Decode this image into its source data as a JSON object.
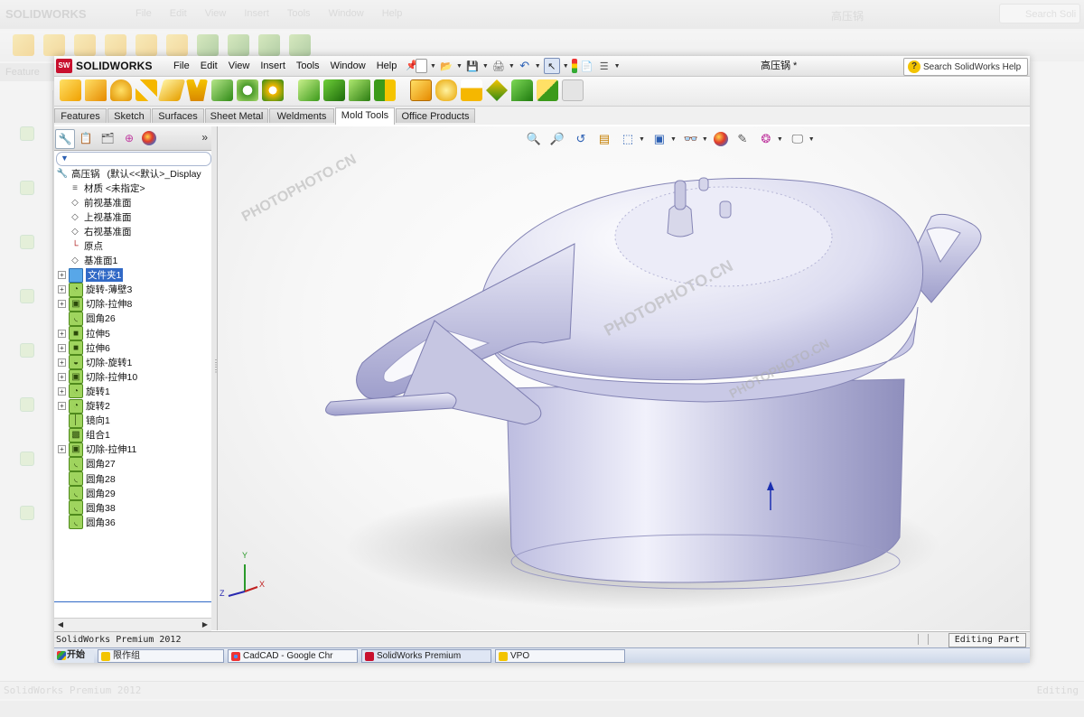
{
  "app": {
    "brand": "SOLIDWORKS",
    "brand_mark": "SW",
    "document_title": "高压锅 *",
    "search_placeholder": "Search SolidWorks Help"
  },
  "menus": [
    "File",
    "Edit",
    "View",
    "Insert",
    "Tools",
    "Window",
    "Help"
  ],
  "command_tabs": [
    {
      "label": "Features",
      "active": false
    },
    {
      "label": "Sketch",
      "active": false
    },
    {
      "label": "Surfaces",
      "active": false
    },
    {
      "label": "Sheet Metal",
      "active": false
    },
    {
      "label": "Weldments",
      "active": false
    },
    {
      "label": "Mold Tools",
      "active": true
    },
    {
      "label": "Office Products",
      "active": false
    }
  ],
  "tree": {
    "root_label": "高压锅",
    "root_config": "(默认<<默认>_Display",
    "items": [
      {
        "label": "材质 <未指定>",
        "icon": "material-icon",
        "expandable": false
      },
      {
        "label": "前视基准面",
        "icon": "plane-icon",
        "expandable": false
      },
      {
        "label": "上视基准面",
        "icon": "plane-icon",
        "expandable": false
      },
      {
        "label": "右视基准面",
        "icon": "plane-icon",
        "expandable": false
      },
      {
        "label": "原点",
        "icon": "origin-icon",
        "expandable": false
      },
      {
        "label": "基准面1",
        "icon": "plane-icon",
        "expandable": false
      },
      {
        "label": "文件夹1",
        "icon": "folder-icon",
        "expandable": true,
        "selected": true
      },
      {
        "label": "旋转-薄壁3",
        "icon": "revolve-icon",
        "expandable": true
      },
      {
        "label": "切除-拉伸8",
        "icon": "cut-extrude-icon",
        "expandable": true
      },
      {
        "label": "圆角26",
        "icon": "fillet-icon",
        "expandable": false
      },
      {
        "label": "拉伸5",
        "icon": "extrude-icon",
        "expandable": true
      },
      {
        "label": "拉伸6",
        "icon": "extrude-icon",
        "expandable": true
      },
      {
        "label": "切除-旋转1",
        "icon": "cut-revolve-icon",
        "expandable": true
      },
      {
        "label": "切除-拉伸10",
        "icon": "cut-extrude-icon",
        "expandable": true
      },
      {
        "label": "旋转1",
        "icon": "revolve-icon",
        "expandable": true
      },
      {
        "label": "旋转2",
        "icon": "revolve-icon",
        "expandable": true
      },
      {
        "label": "镜向1",
        "icon": "mirror-icon",
        "expandable": false
      },
      {
        "label": "组合1",
        "icon": "combine-icon",
        "expandable": false
      },
      {
        "label": "切除-拉伸11",
        "icon": "cut-extrude-icon",
        "expandable": true
      },
      {
        "label": "圆角27",
        "icon": "fillet-icon",
        "expandable": false
      },
      {
        "label": "圆角28",
        "icon": "fillet-icon",
        "expandable": false
      },
      {
        "label": "圆角29",
        "icon": "fillet-icon",
        "expandable": false
      },
      {
        "label": "圆角38",
        "icon": "fillet-icon",
        "expandable": false
      },
      {
        "label": "圆角36",
        "icon": "fillet-icon",
        "expandable": false
      }
    ]
  },
  "viewport": {
    "triad": {
      "x": "X",
      "y": "Y",
      "z": "Z"
    },
    "watermark": "PHOTOPHOTO.CN"
  },
  "status": {
    "left": "SolidWorks Premium 2012",
    "right": "Editing Part"
  },
  "taskbar": [
    "开始",
    "限作组",
    "CadCAD - Google Chr",
    "SolidWorks Premium",
    "VPO"
  ],
  "background": {
    "menus": [
      "File",
      "Edit",
      "View",
      "Insert",
      "Tools",
      "Window",
      "Help"
    ],
    "title": "高压锅",
    "search": "Search Soli",
    "tab": "Feature",
    "status_left": "SolidWorks Premium 2012",
    "status_right": "Editing"
  },
  "colors": {
    "accent": "#c8102e",
    "selection": "#3169c6",
    "feature_icon": "#9fd45e",
    "model_body": "#c8c8e4"
  }
}
